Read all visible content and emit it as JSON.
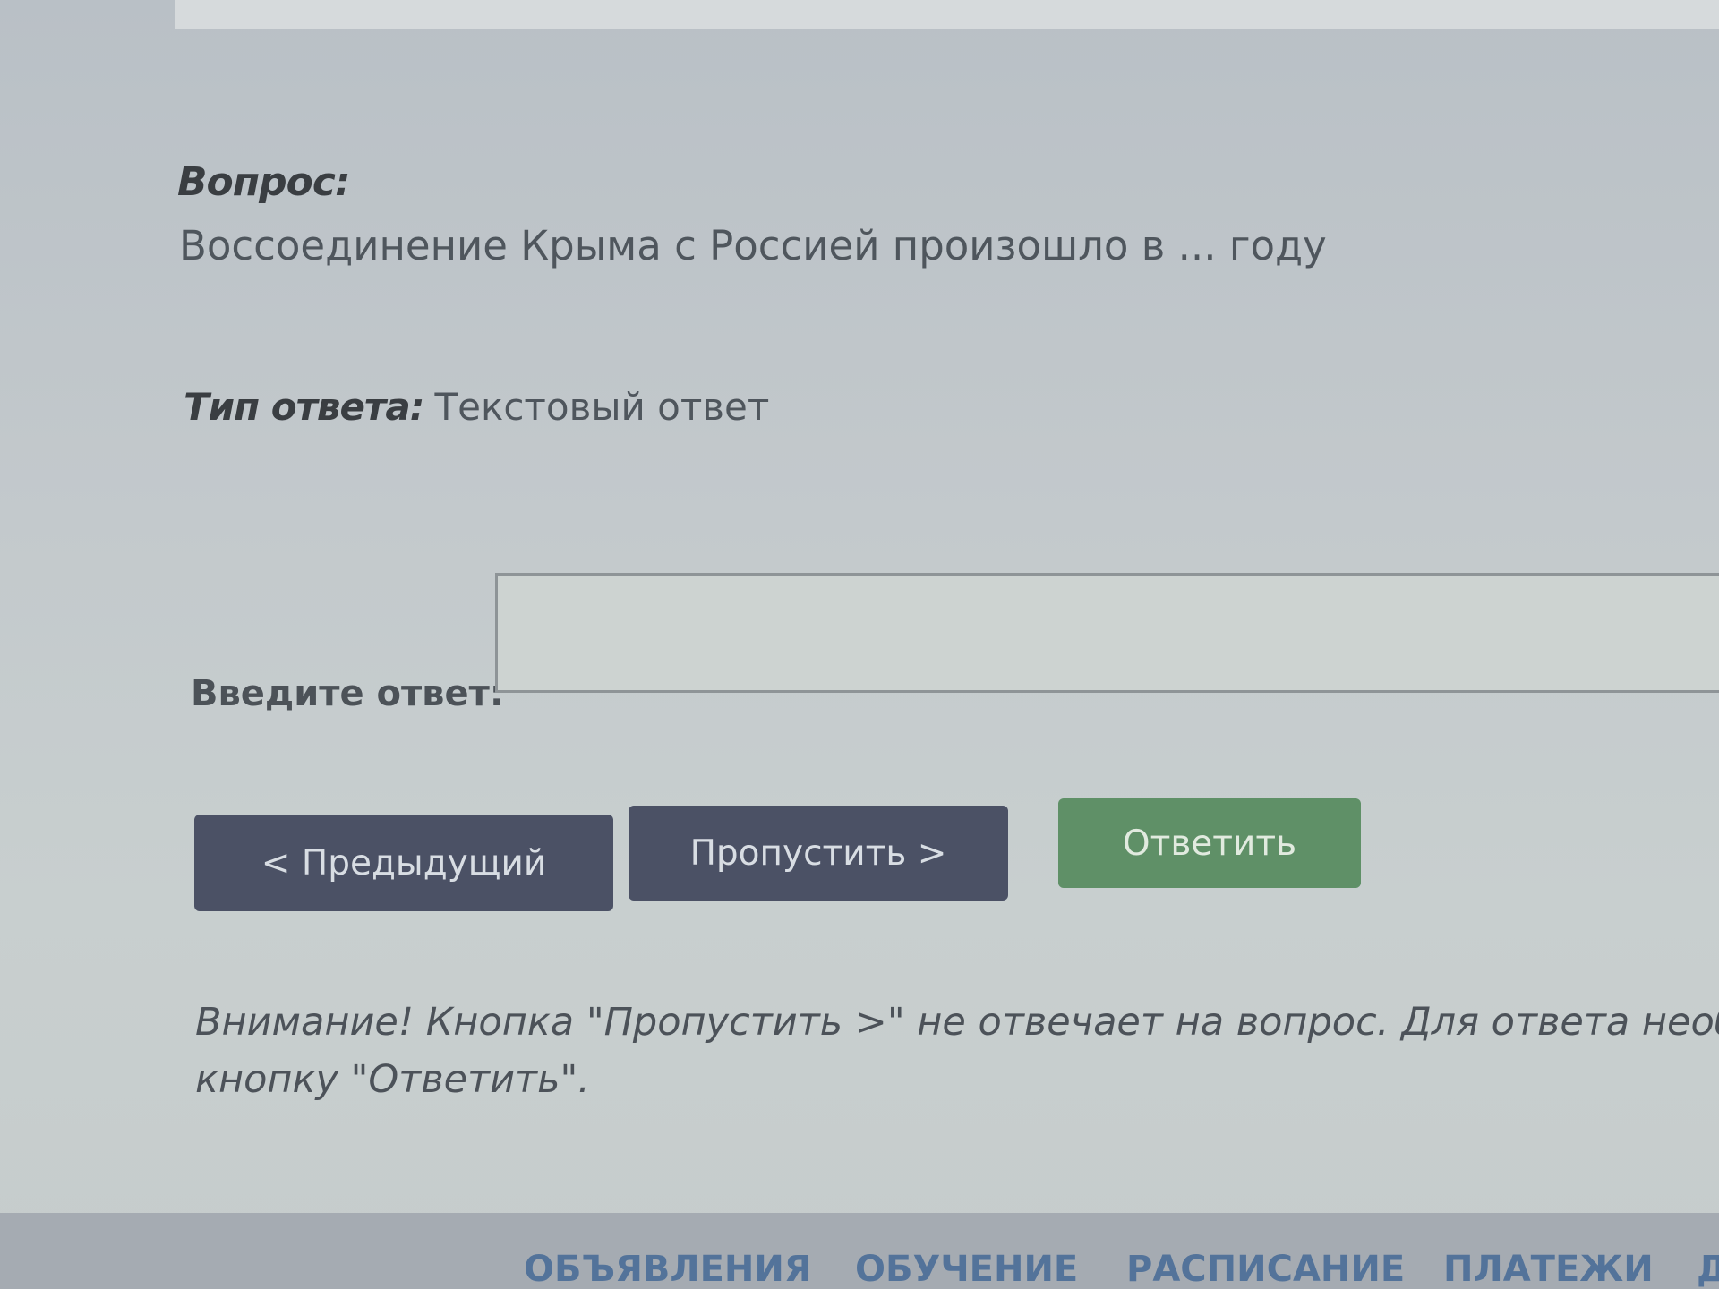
{
  "question": {
    "label": "Вопрос:",
    "text": "Воссоединение Крыма с Россией произошло в ... году"
  },
  "answer_type": {
    "label": "Тип ответа:",
    "value": "Текстовый ответ"
  },
  "answer_field": {
    "label": "Введите ответ:",
    "value": "",
    "placeholder": ""
  },
  "buttons": {
    "prev": "< Предыдущий",
    "skip": "Пропустить >",
    "answer": "Ответить"
  },
  "notice": {
    "line1": "Внимание! Кнопка \"Пропустить >\" не отвечает на вопрос. Для ответа необх",
    "line2": "кнопку \"Ответить\"."
  },
  "nav": {
    "items": [
      "ОБЪЯВЛЕНИЯ",
      "ОБУЧЕНИЕ",
      "РАСПИСАНИЕ",
      "ПЛАТЕЖИ",
      "Д"
    ]
  },
  "colors": {
    "primary_button": "#4b5165",
    "answer_button": "#5f9067",
    "nav_text": "#53739a"
  }
}
